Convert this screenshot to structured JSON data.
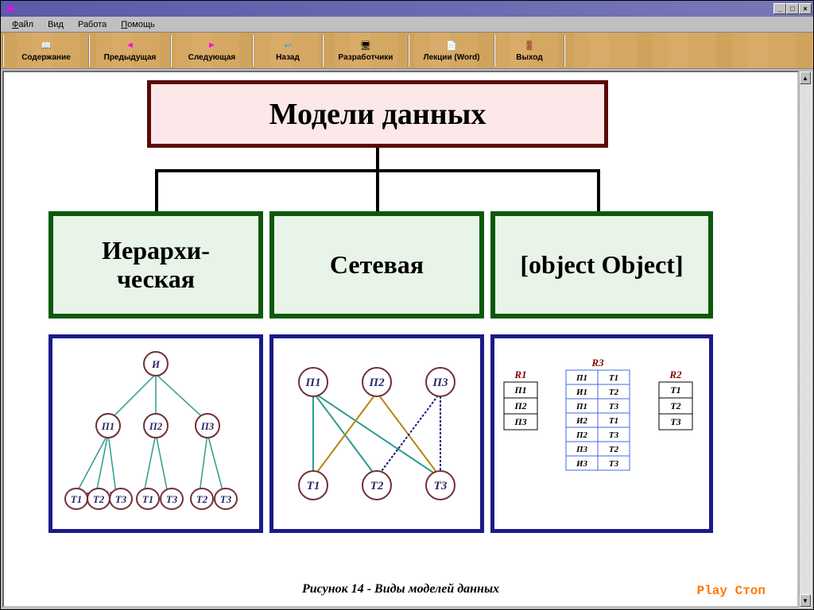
{
  "title": "",
  "menu": {
    "file": "Файл",
    "view": "Вид",
    "work": "Работа",
    "help": "Помощь"
  },
  "toolbar": {
    "contents": "Содержание",
    "prev": "Предыдущая",
    "next": "Следующая",
    "back": "Назад",
    "devs": "Разработчики",
    "lectures": "Лекции (Word)",
    "exit": "Выход"
  },
  "diagram": {
    "main": "Модели данных",
    "hier": "Иерархи-\nческая",
    "net": "Сетевая",
    "rel": {
      "r1": {
        "name": "R1",
        "rows": [
          "П1",
          "П2",
          "П3"
        ]
      },
      "r2": {
        "name": "R2",
        "rows": [
          "Т1",
          "Т2",
          "Т3"
        ]
      },
      "r3": {
        "name": "R3",
        "rows": [
          [
            "П1",
            "Т1"
          ],
          [
            "И1",
            "Т2"
          ],
          [
            "П1",
            "Т3"
          ],
          [
            "И2",
            "Т1"
          ],
          [
            "П2",
            "Т3"
          ],
          [
            "П3",
            "Т2"
          ],
          [
            "И3",
            "Т3"
          ]
        ]
      }
    },
    "caption": "Рисунок 14 - Виды моделей данных",
    "play": "Play",
    "stop": "Стоп",
    "hier_nodes": {
      "root": "И",
      "p": [
        "П1",
        "П2",
        "П3"
      ],
      "t": [
        "Т1",
        "Т2",
        "Т3",
        "Т1",
        "Т3",
        "Т2",
        "Т3"
      ]
    },
    "net_nodes": {
      "p": [
        "П1",
        "П2",
        "П3"
      ],
      "t": [
        "Т1",
        "Т2",
        "Т3"
      ]
    }
  }
}
